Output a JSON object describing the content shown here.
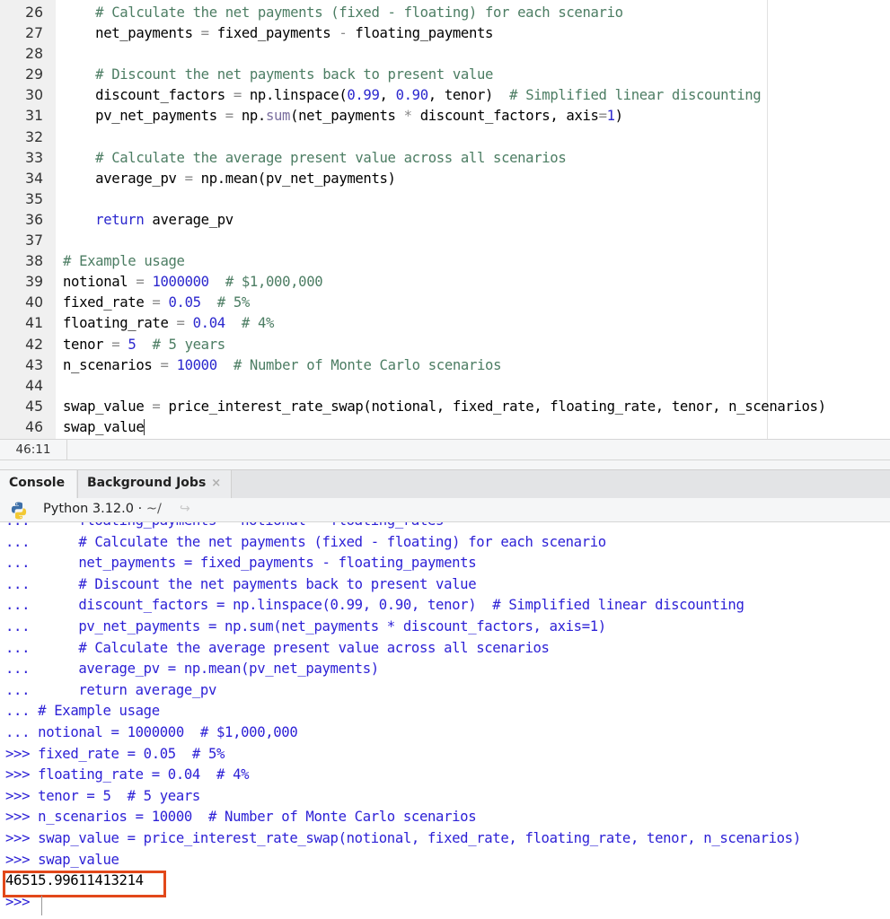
{
  "editor": {
    "lines": [
      {
        "n": "26",
        "tokens": [
          {
            "t": "    "
          },
          {
            "t": "# Calculate the net payments (fixed - floating) for each scenario",
            "c": "comment"
          }
        ]
      },
      {
        "n": "27",
        "tokens": [
          {
            "t": "    net_payments "
          },
          {
            "t": "=",
            "c": "op"
          },
          {
            "t": " fixed_payments "
          },
          {
            "t": "-",
            "c": "op"
          },
          {
            "t": " floating_payments"
          }
        ]
      },
      {
        "n": "28",
        "tokens": []
      },
      {
        "n": "29",
        "tokens": [
          {
            "t": "    "
          },
          {
            "t": "# Discount the net payments back to present value",
            "c": "comment"
          }
        ]
      },
      {
        "n": "30",
        "tokens": [
          {
            "t": "    discount_factors "
          },
          {
            "t": "=",
            "c": "op"
          },
          {
            "t": " np.linspace("
          },
          {
            "t": "0.99",
            "c": "num"
          },
          {
            "t": ", "
          },
          {
            "t": "0.90",
            "c": "num"
          },
          {
            "t": ", tenor)  "
          },
          {
            "t": "# Simplified linear discounting",
            "c": "comment"
          }
        ]
      },
      {
        "n": "31",
        "tokens": [
          {
            "t": "    pv_net_payments "
          },
          {
            "t": "=",
            "c": "op"
          },
          {
            "t": " np."
          },
          {
            "t": "sum",
            "c": "builtin"
          },
          {
            "t": "(net_payments "
          },
          {
            "t": "*",
            "c": "op"
          },
          {
            "t": " discount_factors, axis"
          },
          {
            "t": "=",
            "c": "op"
          },
          {
            "t": "1",
            "c": "num"
          },
          {
            "t": ")"
          }
        ]
      },
      {
        "n": "32",
        "tokens": []
      },
      {
        "n": "33",
        "tokens": [
          {
            "t": "    "
          },
          {
            "t": "# Calculate the average present value across all scenarios",
            "c": "comment"
          }
        ]
      },
      {
        "n": "34",
        "tokens": [
          {
            "t": "    average_pv "
          },
          {
            "t": "=",
            "c": "op"
          },
          {
            "t": " np.mean(pv_net_payments)"
          }
        ]
      },
      {
        "n": "35",
        "tokens": []
      },
      {
        "n": "36",
        "tokens": [
          {
            "t": "    "
          },
          {
            "t": "return",
            "c": "kw"
          },
          {
            "t": " average_pv"
          }
        ]
      },
      {
        "n": "37",
        "tokens": []
      },
      {
        "n": "38",
        "tokens": [
          {
            "t": "# Example usage",
            "c": "comment"
          }
        ]
      },
      {
        "n": "39",
        "tokens": [
          {
            "t": "notional "
          },
          {
            "t": "=",
            "c": "op"
          },
          {
            "t": " "
          },
          {
            "t": "1000000",
            "c": "num"
          },
          {
            "t": "  "
          },
          {
            "t": "# $1,000,000",
            "c": "comment"
          }
        ]
      },
      {
        "n": "40",
        "tokens": [
          {
            "t": "fixed_rate "
          },
          {
            "t": "=",
            "c": "op"
          },
          {
            "t": " "
          },
          {
            "t": "0.05",
            "c": "num"
          },
          {
            "t": "  "
          },
          {
            "t": "# 5%",
            "c": "comment"
          }
        ]
      },
      {
        "n": "41",
        "tokens": [
          {
            "t": "floating_rate "
          },
          {
            "t": "=",
            "c": "op"
          },
          {
            "t": " "
          },
          {
            "t": "0.04",
            "c": "num"
          },
          {
            "t": "  "
          },
          {
            "t": "# 4%",
            "c": "comment"
          }
        ]
      },
      {
        "n": "42",
        "tokens": [
          {
            "t": "tenor "
          },
          {
            "t": "=",
            "c": "op"
          },
          {
            "t": " "
          },
          {
            "t": "5",
            "c": "num"
          },
          {
            "t": "  "
          },
          {
            "t": "# 5 years",
            "c": "comment"
          }
        ]
      },
      {
        "n": "43",
        "tokens": [
          {
            "t": "n_scenarios "
          },
          {
            "t": "=",
            "c": "op"
          },
          {
            "t": " "
          },
          {
            "t": "10000",
            "c": "num"
          },
          {
            "t": "  "
          },
          {
            "t": "# Number of Monte Carlo scenarios",
            "c": "comment"
          }
        ]
      },
      {
        "n": "44",
        "tokens": []
      },
      {
        "n": "45",
        "tokens": [
          {
            "t": "swap_value "
          },
          {
            "t": "=",
            "c": "op"
          },
          {
            "t": " price_interest_rate_swap(notional, fixed_rate, floating_rate, tenor, n_scenarios)"
          }
        ]
      },
      {
        "n": "46",
        "tokens": [
          {
            "t": "swap_value"
          }
        ],
        "cursor": true
      }
    ]
  },
  "statusbar": {
    "cursor_position": "46:11"
  },
  "console_tabs": [
    {
      "label": "Console",
      "active": true
    },
    {
      "label": "Background Jobs",
      "active": false,
      "closable": true,
      "close_glyph": "×"
    }
  ],
  "console_header": {
    "interpreter": "Python 3.12.0",
    "separator": " · ",
    "working_dir": "~/",
    "goto_icon": "↪"
  },
  "console": {
    "lines": [
      {
        "prompt": "...",
        "text": "      floating_payments = notional * floating_rates"
      },
      {
        "prompt": "...",
        "text": "      # Calculate the net payments (fixed - floating) for each scenario"
      },
      {
        "prompt": "...",
        "text": "      net_payments = fixed_payments - floating_payments"
      },
      {
        "prompt": "...",
        "text": "      # Discount the net payments back to present value"
      },
      {
        "prompt": "...",
        "text": "      discount_factors = np.linspace(0.99, 0.90, tenor)  # Simplified linear discounting"
      },
      {
        "prompt": "...",
        "text": "      pv_net_payments = np.sum(net_payments * discount_factors, axis=1)"
      },
      {
        "prompt": "...",
        "text": "      # Calculate the average present value across all scenarios"
      },
      {
        "prompt": "...",
        "text": "      average_pv = np.mean(pv_net_payments)"
      },
      {
        "prompt": "...",
        "text": "      return average_pv"
      },
      {
        "prompt": "...",
        "text": " # Example usage"
      },
      {
        "prompt": "...",
        "text": " notional = 1000000  # $1,000,000"
      },
      {
        "prompt": ">>>",
        "text": " fixed_rate = 0.05  # 5%"
      },
      {
        "prompt": ">>>",
        "text": " floating_rate = 0.04  # 4%"
      },
      {
        "prompt": ">>>",
        "text": " tenor = 5  # 5 years"
      },
      {
        "prompt": ">>>",
        "text": " n_scenarios = 10000  # Number of Monte Carlo scenarios"
      },
      {
        "prompt": ">>>",
        "text": " swap_value = price_interest_rate_swap(notional, fixed_rate, floating_rate, tenor, n_scenarios)"
      },
      {
        "prompt": ">>>",
        "text": " swap_value"
      }
    ],
    "result": "46515.99611413214",
    "final_prompt": ">>>"
  },
  "colors": {
    "comment": "#4c7d63",
    "number": "#2b27ce",
    "keyword": "#2b27ce",
    "console_text": "#2d21d6",
    "highlight_box": "#e2481a"
  }
}
